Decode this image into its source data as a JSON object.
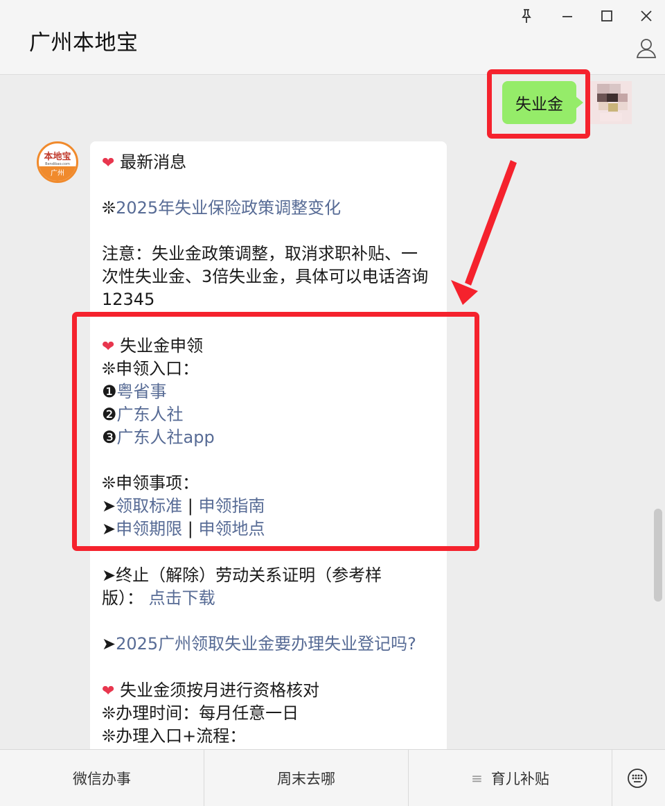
{
  "window": {
    "title": "广州本地宝",
    "pin_icon": "pin-icon",
    "minimize_icon": "minimize-icon",
    "maximize_icon": "maximize-icon",
    "close_icon": "close-icon",
    "profile_icon": "person-icon"
  },
  "my_message": {
    "text": "失业金"
  },
  "bot_avatar": {
    "logo_text": "本地宝",
    "logo_sub": "Bendibao.com",
    "logo_city": "广州"
  },
  "reply": {
    "latest_heading": "最新消息",
    "policy_prefix": "❊",
    "policy_link": "2025年失业保险政策调整变化",
    "notice_line1": "注意：失业金政策调整，取消求职补贴、一",
    "notice_line2": "次性失业金、3倍失业金，具体可以电话咨询",
    "notice_line3": "12345",
    "apply_heading": "失业金申领",
    "apply_entry_title": "❊申领入口：",
    "entry1_num": "❶",
    "entry1_link": "粤省事",
    "entry2_num": "❷",
    "entry2_link": "广东人社",
    "entry3_num": "❸",
    "entry3_link": "广东人社app",
    "matters_title": "❊申领事项：",
    "arrow": "➤",
    "separator": " | ",
    "standard_link": "领取标准",
    "guide_link": "申领指南",
    "period_link": "申领期限",
    "place_link": "申领地点",
    "termination_line1": "➤终止（解除）劳动关系证明（参考样",
    "termination_line2": "版）：",
    "download_link": "点击下载",
    "register_link": "2025广州领取失业金要办理失业登记吗?",
    "check_heading": "失业金须按月进行资格核对",
    "check_time": "❊办理时间：每月任意一日",
    "check_entry": "❊办理入口+流程："
  },
  "menu": {
    "item1": "微信办事",
    "item2": "周末去哪",
    "item3": "育儿补贴",
    "item3_icon": "≡",
    "keyboard_icon": "keyboard-icon"
  },
  "colors": {
    "link": "#576b95",
    "annotation": "#f5222d",
    "my_bubble": "#95ec69",
    "heart": "#e8364e"
  }
}
